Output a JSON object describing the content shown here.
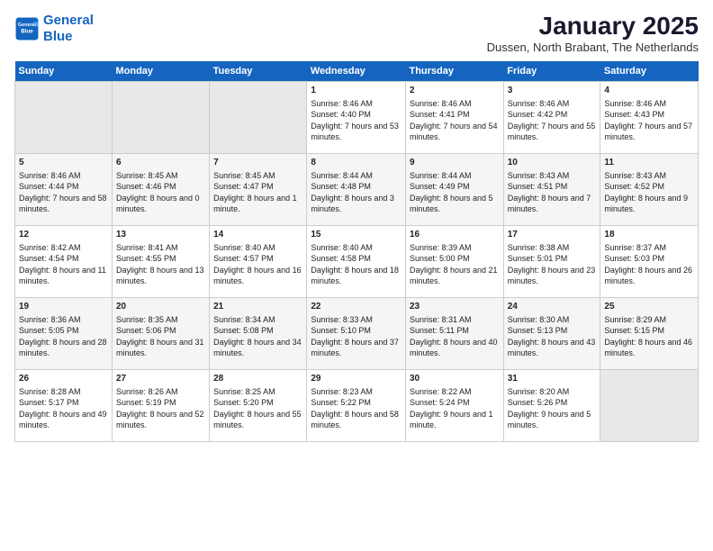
{
  "logo": {
    "line1": "General",
    "line2": "Blue"
  },
  "title": "January 2025",
  "subtitle": "Dussen, North Brabant, The Netherlands",
  "days_of_week": [
    "Sunday",
    "Monday",
    "Tuesday",
    "Wednesday",
    "Thursday",
    "Friday",
    "Saturday"
  ],
  "weeks": [
    [
      {
        "day": "",
        "content": ""
      },
      {
        "day": "",
        "content": ""
      },
      {
        "day": "",
        "content": ""
      },
      {
        "day": "1",
        "content": "Sunrise: 8:46 AM\nSunset: 4:40 PM\nDaylight: 7 hours and 53 minutes."
      },
      {
        "day": "2",
        "content": "Sunrise: 8:46 AM\nSunset: 4:41 PM\nDaylight: 7 hours and 54 minutes."
      },
      {
        "day": "3",
        "content": "Sunrise: 8:46 AM\nSunset: 4:42 PM\nDaylight: 7 hours and 55 minutes."
      },
      {
        "day": "4",
        "content": "Sunrise: 8:46 AM\nSunset: 4:43 PM\nDaylight: 7 hours and 57 minutes."
      }
    ],
    [
      {
        "day": "5",
        "content": "Sunrise: 8:46 AM\nSunset: 4:44 PM\nDaylight: 7 hours and 58 minutes."
      },
      {
        "day": "6",
        "content": "Sunrise: 8:45 AM\nSunset: 4:46 PM\nDaylight: 8 hours and 0 minutes."
      },
      {
        "day": "7",
        "content": "Sunrise: 8:45 AM\nSunset: 4:47 PM\nDaylight: 8 hours and 1 minute."
      },
      {
        "day": "8",
        "content": "Sunrise: 8:44 AM\nSunset: 4:48 PM\nDaylight: 8 hours and 3 minutes."
      },
      {
        "day": "9",
        "content": "Sunrise: 8:44 AM\nSunset: 4:49 PM\nDaylight: 8 hours and 5 minutes."
      },
      {
        "day": "10",
        "content": "Sunrise: 8:43 AM\nSunset: 4:51 PM\nDaylight: 8 hours and 7 minutes."
      },
      {
        "day": "11",
        "content": "Sunrise: 8:43 AM\nSunset: 4:52 PM\nDaylight: 8 hours and 9 minutes."
      }
    ],
    [
      {
        "day": "12",
        "content": "Sunrise: 8:42 AM\nSunset: 4:54 PM\nDaylight: 8 hours and 11 minutes."
      },
      {
        "day": "13",
        "content": "Sunrise: 8:41 AM\nSunset: 4:55 PM\nDaylight: 8 hours and 13 minutes."
      },
      {
        "day": "14",
        "content": "Sunrise: 8:40 AM\nSunset: 4:57 PM\nDaylight: 8 hours and 16 minutes."
      },
      {
        "day": "15",
        "content": "Sunrise: 8:40 AM\nSunset: 4:58 PM\nDaylight: 8 hours and 18 minutes."
      },
      {
        "day": "16",
        "content": "Sunrise: 8:39 AM\nSunset: 5:00 PM\nDaylight: 8 hours and 21 minutes."
      },
      {
        "day": "17",
        "content": "Sunrise: 8:38 AM\nSunset: 5:01 PM\nDaylight: 8 hours and 23 minutes."
      },
      {
        "day": "18",
        "content": "Sunrise: 8:37 AM\nSunset: 5:03 PM\nDaylight: 8 hours and 26 minutes."
      }
    ],
    [
      {
        "day": "19",
        "content": "Sunrise: 8:36 AM\nSunset: 5:05 PM\nDaylight: 8 hours and 28 minutes."
      },
      {
        "day": "20",
        "content": "Sunrise: 8:35 AM\nSunset: 5:06 PM\nDaylight: 8 hours and 31 minutes."
      },
      {
        "day": "21",
        "content": "Sunrise: 8:34 AM\nSunset: 5:08 PM\nDaylight: 8 hours and 34 minutes."
      },
      {
        "day": "22",
        "content": "Sunrise: 8:33 AM\nSunset: 5:10 PM\nDaylight: 8 hours and 37 minutes."
      },
      {
        "day": "23",
        "content": "Sunrise: 8:31 AM\nSunset: 5:11 PM\nDaylight: 8 hours and 40 minutes."
      },
      {
        "day": "24",
        "content": "Sunrise: 8:30 AM\nSunset: 5:13 PM\nDaylight: 8 hours and 43 minutes."
      },
      {
        "day": "25",
        "content": "Sunrise: 8:29 AM\nSunset: 5:15 PM\nDaylight: 8 hours and 46 minutes."
      }
    ],
    [
      {
        "day": "26",
        "content": "Sunrise: 8:28 AM\nSunset: 5:17 PM\nDaylight: 8 hours and 49 minutes."
      },
      {
        "day": "27",
        "content": "Sunrise: 8:26 AM\nSunset: 5:19 PM\nDaylight: 8 hours and 52 minutes."
      },
      {
        "day": "28",
        "content": "Sunrise: 8:25 AM\nSunset: 5:20 PM\nDaylight: 8 hours and 55 minutes."
      },
      {
        "day": "29",
        "content": "Sunrise: 8:23 AM\nSunset: 5:22 PM\nDaylight: 8 hours and 58 minutes."
      },
      {
        "day": "30",
        "content": "Sunrise: 8:22 AM\nSunset: 5:24 PM\nDaylight: 9 hours and 1 minute."
      },
      {
        "day": "31",
        "content": "Sunrise: 8:20 AM\nSunset: 5:26 PM\nDaylight: 9 hours and 5 minutes."
      },
      {
        "day": "",
        "content": ""
      }
    ]
  ]
}
